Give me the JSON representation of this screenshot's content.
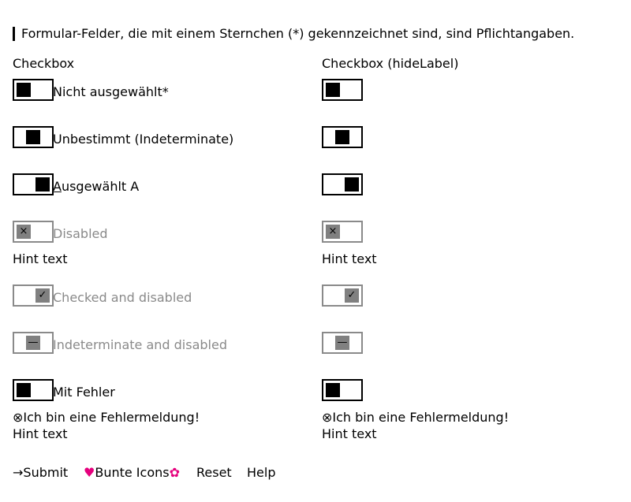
{
  "note": "Formular-Felder, die mit einem Sternchen (*) gekennzeichnet sind, sind Pflichtangaben.",
  "columns": [
    {
      "heading": "Checkbox"
    },
    {
      "heading": "Checkbox (hideLabel)"
    }
  ],
  "items": {
    "unchecked": {
      "label": "Nicht ausgewählt*"
    },
    "indeterminate": {
      "label": "Unbestimmt (Indeterminate)"
    },
    "checked": {
      "access_key": "A",
      "label_rest": "usgewählt A"
    },
    "disabled": {
      "label": "Disabled",
      "glyph": "×"
    },
    "checked_disabled": {
      "label": "Checked and disabled",
      "glyph": "✓"
    },
    "indeterminate_disabled": {
      "label": "Indeterminate and disabled",
      "glyph": "—"
    },
    "error": {
      "label": "Mit Fehler",
      "error_icon": "⊗",
      "error_text": "Ich bin eine Fehlermeldung!"
    }
  },
  "hint_text": "Hint text",
  "footer": {
    "submit": {
      "icon": "→",
      "label": "Submit"
    },
    "colorful": {
      "icon": "♥",
      "label": "Bunte Icons",
      "trailing_icon": "✿"
    },
    "reset": {
      "label": "Reset"
    },
    "help": {
      "label": "Help"
    }
  },
  "colors": {
    "heart": "#e5007d",
    "trailing_icon": "#e5007d",
    "disabled_text": "#8a8a8a"
  }
}
